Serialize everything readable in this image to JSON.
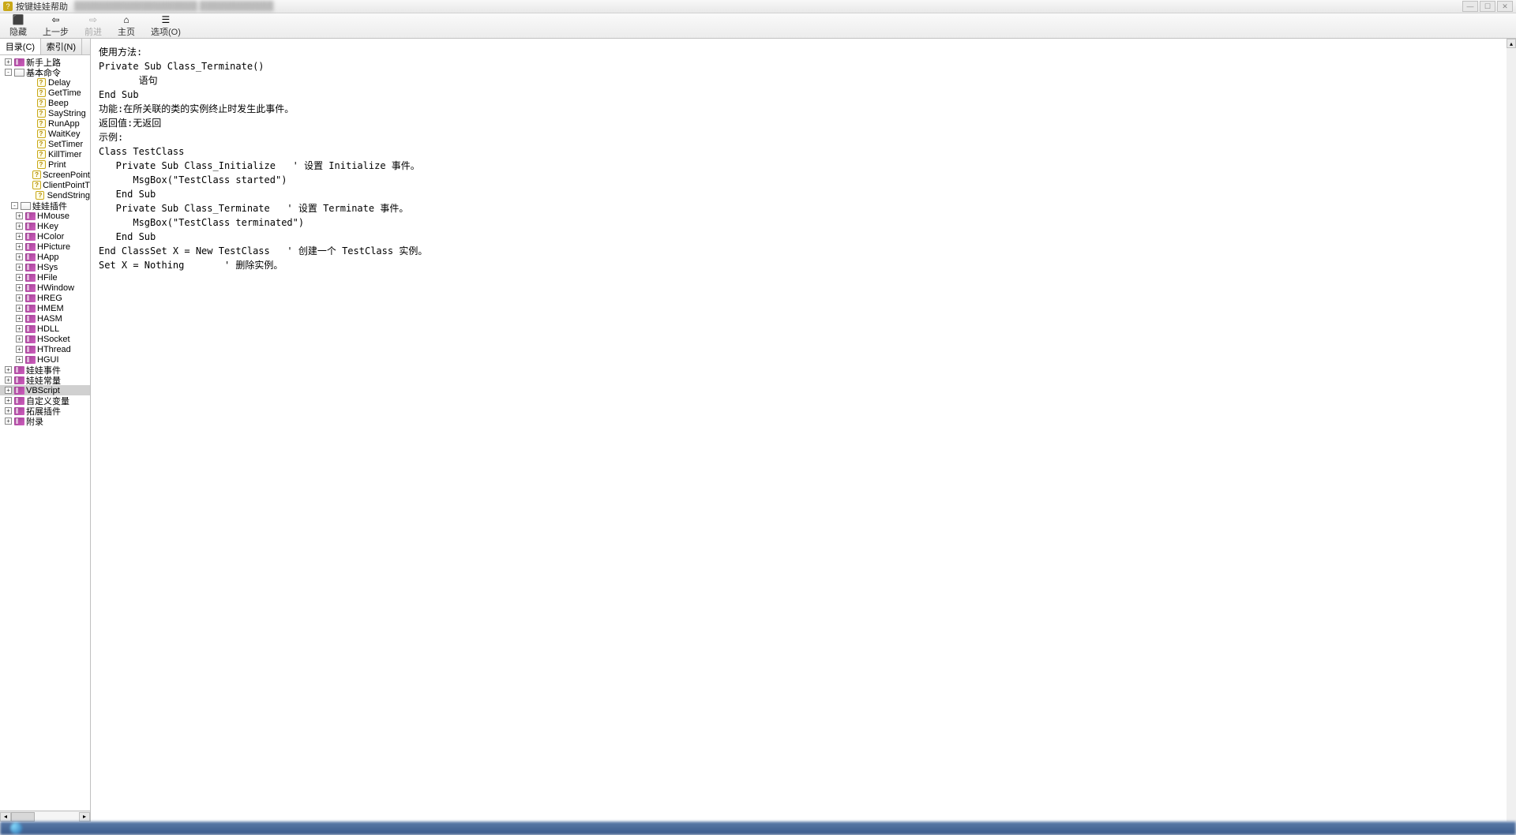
{
  "titlebar": {
    "app_title": "按键娃娃帮助",
    "blur_text": "████████████████████  ████████████"
  },
  "toolbar": {
    "hide": "隐藏",
    "back": "上一步",
    "forward": "前进",
    "home": "主页",
    "options": "选项(O)"
  },
  "tabs": {
    "toc": "目录(C)",
    "index": "索引(N)"
  },
  "tree": {
    "l1": [
      {
        "t": "toggle",
        "exp": "+",
        "icon": "book",
        "label": "新手上路",
        "d": 0
      },
      {
        "t": "toggle",
        "exp": "-",
        "icon": "open",
        "label": "基本命令",
        "d": 0
      },
      {
        "t": "leaf",
        "icon": "help",
        "label": "Delay",
        "d": 2
      },
      {
        "t": "leaf",
        "icon": "help",
        "label": "GetTime",
        "d": 2
      },
      {
        "t": "leaf",
        "icon": "help",
        "label": "Beep",
        "d": 2
      },
      {
        "t": "leaf",
        "icon": "help",
        "label": "SayString",
        "d": 2
      },
      {
        "t": "leaf",
        "icon": "help",
        "label": "RunApp",
        "d": 2
      },
      {
        "t": "leaf",
        "icon": "help",
        "label": "WaitKey",
        "d": 2
      },
      {
        "t": "leaf",
        "icon": "help",
        "label": "SetTimer",
        "d": 2
      },
      {
        "t": "leaf",
        "icon": "help",
        "label": "KillTimer",
        "d": 2
      },
      {
        "t": "leaf",
        "icon": "help",
        "label": "Print",
        "d": 2
      },
      {
        "t": "leaf",
        "icon": "help",
        "label": "ScreenPoint",
        "d": 2
      },
      {
        "t": "leaf",
        "icon": "help",
        "label": "ClientPointT",
        "d": 2
      },
      {
        "t": "leaf",
        "icon": "help",
        "label": "SendString",
        "d": 2
      },
      {
        "t": "toggle",
        "exp": "-",
        "icon": "open",
        "label": "娃娃插件",
        "d": 0,
        "align": "right"
      },
      {
        "t": "toggle",
        "exp": "+",
        "icon": "book",
        "label": "HMouse",
        "d": 1
      },
      {
        "t": "toggle",
        "exp": "+",
        "icon": "book",
        "label": "HKey",
        "d": 1
      },
      {
        "t": "toggle",
        "exp": "+",
        "icon": "book",
        "label": "HColor",
        "d": 1
      },
      {
        "t": "toggle",
        "exp": "+",
        "icon": "book",
        "label": "HPicture",
        "d": 1
      },
      {
        "t": "toggle",
        "exp": "+",
        "icon": "book",
        "label": "HApp",
        "d": 1
      },
      {
        "t": "toggle",
        "exp": "+",
        "icon": "book",
        "label": "HSys",
        "d": 1
      },
      {
        "t": "toggle",
        "exp": "+",
        "icon": "book",
        "label": "HFile",
        "d": 1
      },
      {
        "t": "toggle",
        "exp": "+",
        "icon": "book",
        "label": "HWindow",
        "d": 1
      },
      {
        "t": "toggle",
        "exp": "+",
        "icon": "book",
        "label": "HREG",
        "d": 1
      },
      {
        "t": "toggle",
        "exp": "+",
        "icon": "book",
        "label": "HMEM",
        "d": 1
      },
      {
        "t": "toggle",
        "exp": "+",
        "icon": "book",
        "label": "HASM",
        "d": 1
      },
      {
        "t": "toggle",
        "exp": "+",
        "icon": "book",
        "label": "HDLL",
        "d": 1
      },
      {
        "t": "toggle",
        "exp": "+",
        "icon": "book",
        "label": "HSocket",
        "d": 1
      },
      {
        "t": "toggle",
        "exp": "+",
        "icon": "book",
        "label": "HThread",
        "d": 1
      },
      {
        "t": "toggle",
        "exp": "+",
        "icon": "book",
        "label": "HGUI",
        "d": 1
      },
      {
        "t": "toggle",
        "exp": "+",
        "icon": "book",
        "label": "娃娃事件",
        "d": 0
      },
      {
        "t": "toggle",
        "exp": "+",
        "icon": "book",
        "label": "娃娃常量",
        "d": 0
      },
      {
        "t": "toggle",
        "exp": "+",
        "icon": "book",
        "label": "VBScript",
        "d": 0,
        "sel": true
      },
      {
        "t": "toggle",
        "exp": "+",
        "icon": "book",
        "label": "自定义变量",
        "d": 0
      },
      {
        "t": "toggle",
        "exp": "+",
        "icon": "book",
        "label": "拓展插件",
        "d": 0
      },
      {
        "t": "toggle",
        "exp": "+",
        "icon": "book",
        "label": "附录",
        "d": 0
      }
    ]
  },
  "content_text": "使用方法:\nPrivate Sub Class_Terminate()\n       语句\nEnd Sub\n功能:在所关联的类的实例终止时发生此事件。\n返回值:无返回\n示例:\nClass TestClass\n   Private Sub Class_Initialize   ' 设置 Initialize 事件。\n      MsgBox(\"TestClass started\")\n   End Sub\n   Private Sub Class_Terminate   ' 设置 Terminate 事件。\n      MsgBox(\"TestClass terminated\")\n   End Sub\nEnd ClassSet X = New TestClass   ' 创建一个 TestClass 实例。\nSet X = Nothing       ' 删除实例。"
}
